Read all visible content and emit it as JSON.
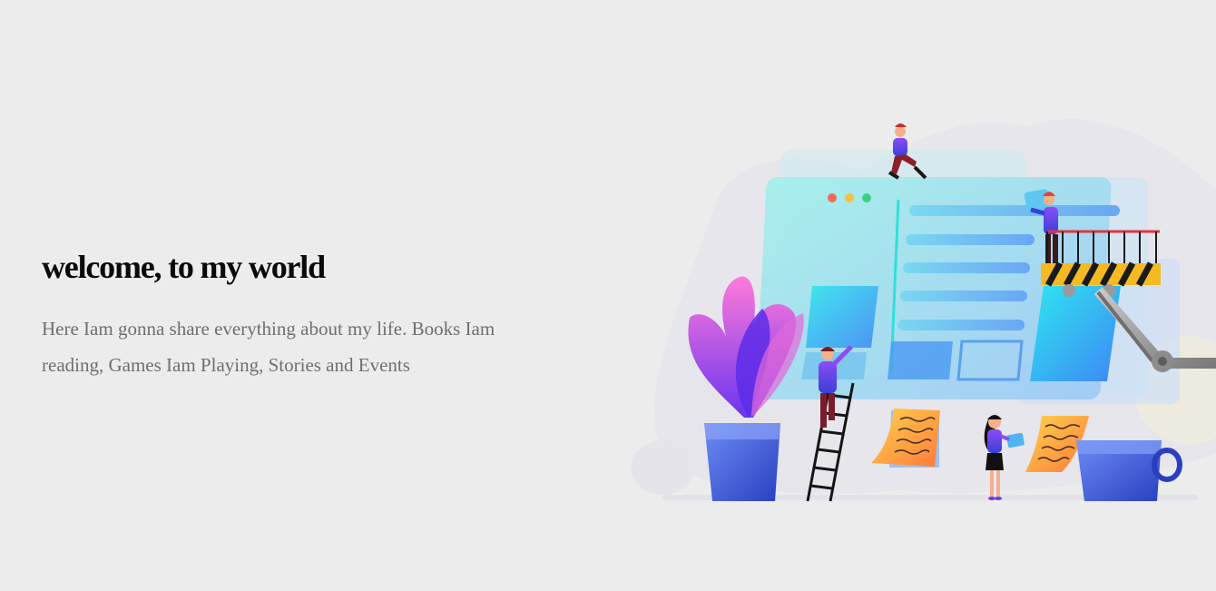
{
  "hero": {
    "title": "welcome, to my world",
    "description": "Here Iam gonna share everything about my life. Books Iam reading, Games Iam Playing, Stories and Events"
  },
  "illustration": {
    "icon": "website-builders-illustration"
  },
  "colors": {
    "background": "#ececec",
    "title": "#0b0b0b",
    "description": "#6f6f6f",
    "accent_purple": "#6a3cf0",
    "accent_cyan": "#3fd6e6",
    "accent_orange": "#ff8a3d"
  }
}
